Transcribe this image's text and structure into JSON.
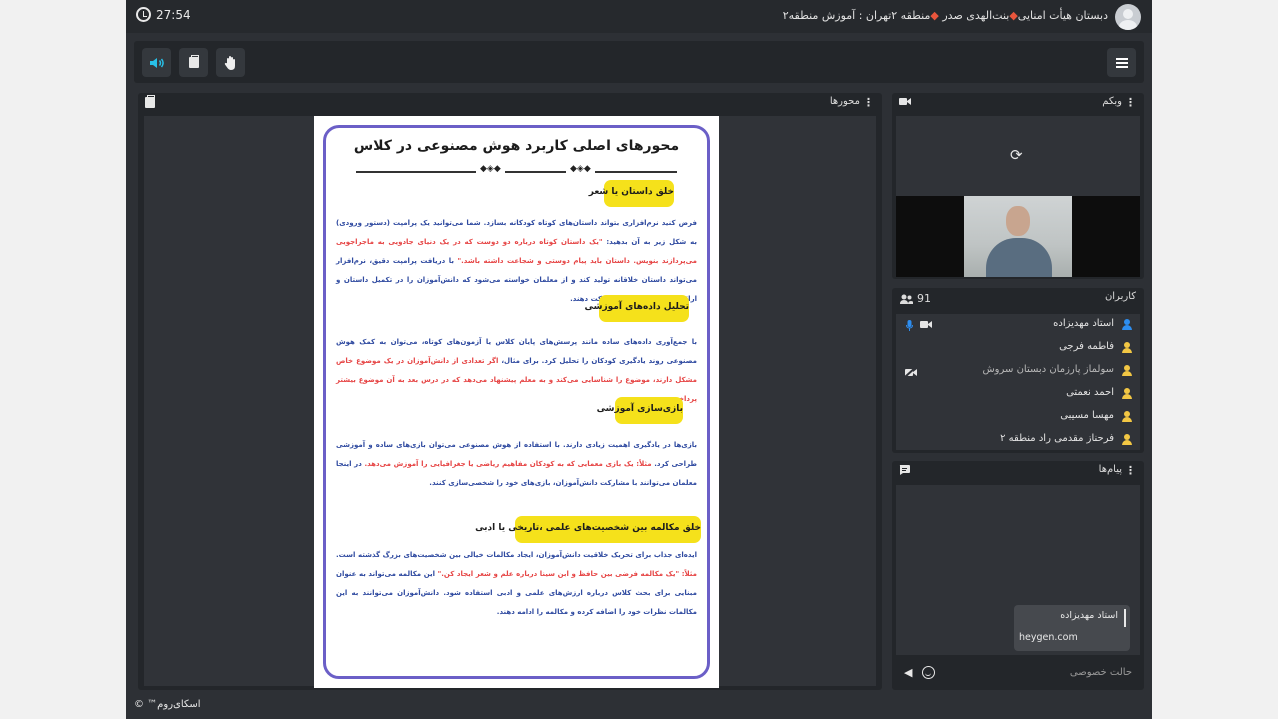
{
  "topbar": {
    "timer": "27:54",
    "room_title_parts": [
      "دبستان هیأت امنایی",
      "بنت‌الهدی صدر",
      "منطقه ۲تهران : آموزش منطقه۲"
    ]
  },
  "toolbar": {
    "speaker_icon": "speaker-icon",
    "documents_icon": "documents-icon",
    "raise_hand_icon": "raise-hand-icon",
    "menu_icon": "hamburger-menu-icon"
  },
  "presentation": {
    "title": "محورها",
    "slide": {
      "title": "محورهای اصلی کاربرد هوش مصنوعی در کلاس",
      "sections": [
        {
          "heading": "خلق داستان یا شعر",
          "p1": "فرض کنید نرم‌افزاری بتواند داستان‌های کوتاه کودکانه بسازد. شما می‌توانید یک پرامپت (دستور ورودی) به شکل زیر به آن بدهید:",
          "p2_red": "\"یک داستان کوتاه درباره دو دوست که در یک دنیای جادویی به ماجراجویی می‌پردازند بنویس. داستان باید پیام دوستی و شجاعت داشته باشد.\"",
          "p3": "با دریافت پرامپت دقیق، نرم‌افزار می‌تواند داستان خلاقانه تولید کند و از معلمان خواسته می‌شود که دانش‌آموزان را در تکمیل داستان و ارائه پایان‌های مختلف مشارکت دهند."
        },
        {
          "heading": "تحلیل داده‌های آموزشی",
          "p1": "با جمع‌آوری داده‌های ساده مانند پرسش‌های پایان کلاس یا آزمون‌های کوتاه، می‌توان به کمک هوش مصنوعی روند یادگیری کودکان را تحلیل کرد. برای مثال،",
          "p2_red": "اگر تعدادی از دانش‌آموزان در یک موضوع خاص مشکل دارند، موضوع را شناسایی می‌کند و به معلم پیشنهاد می‌دهد که در درس بعد به آن موضوع بیشتر پرداخته شود."
        },
        {
          "heading": "بازی‌سازی آموزشی",
          "p1": "بازی‌ها در یادگیری اهمیت زیادی دارند. با استفاده از هوش مصنوعی می‌توان بازی‌های ساده و آموزشی طراحی کرد.",
          "p2_red": "مثلاً: یک بازی معمایی که به کودکان مفاهیم ریاضی یا جغرافیایی را آموزش می‌دهد.",
          "p3": "در اینجا معلمان می‌توانند با مشارکت دانش‌آموزان، بازی‌های خود را شخصی‌سازی کنند."
        },
        {
          "heading": "خلق مکالمه بین شخصیت‌های علمی ،تاریخی یا ادبی",
          "p1": "ایده‌ای جذاب برای تحریک خلاقیت دانش‌آموزان، ایجاد مکالمات خیالی بین شخصیت‌های بزرگ گذشته است.",
          "p2_red": "مثلاً: \"یک مکالمه فرضی بین حافظ و ابن سینا درباره علم و شعر ایجاد کن.\"",
          "p3": "این مکالمه می‌تواند به عنوان مبنایی برای بحث کلاس درباره ارزش‌های علمی و ادبی استفاده شود. دانش‌آموزان می‌توانند به این مکالمات نظرات خود را اضافه کرده و مکالمه را ادامه دهند."
        }
      ]
    }
  },
  "webcam": {
    "title": "وبکم"
  },
  "users": {
    "title": "کاربران",
    "count": "91",
    "list": [
      {
        "name": "استاد مهدیزاده",
        "color": "#2d8ef0",
        "dim": false
      },
      {
        "name": "فاطمه فرجی",
        "color": "#f2c744",
        "dim": false
      },
      {
        "name": "سولماز پارزمان دبستان سروش",
        "color": "#f2c744",
        "dim": true
      },
      {
        "name": "احمد نعمتی",
        "color": "#f2c744",
        "dim": false
      },
      {
        "name": "مهسا مسیبی",
        "color": "#f2c744",
        "dim": false
      },
      {
        "name": "فرحناز مقدمی راد منطقه ۲",
        "color": "#f2c744",
        "dim": false
      }
    ]
  },
  "chat": {
    "title": "پیام‌ها",
    "messages": [
      {
        "sender": "استاد مهدیزاده",
        "text": "heygen.com"
      }
    ],
    "input_placeholder": "حالت خصوصی"
  },
  "footer": {
    "brand": "اسکای‌روم™ ©"
  },
  "colors": {
    "accent": "#28c0e8",
    "highlight": "#f5e11b",
    "frame": "#6b5fc7",
    "slide_blue": "#2f4aa0",
    "slide_red": "#e64545"
  }
}
